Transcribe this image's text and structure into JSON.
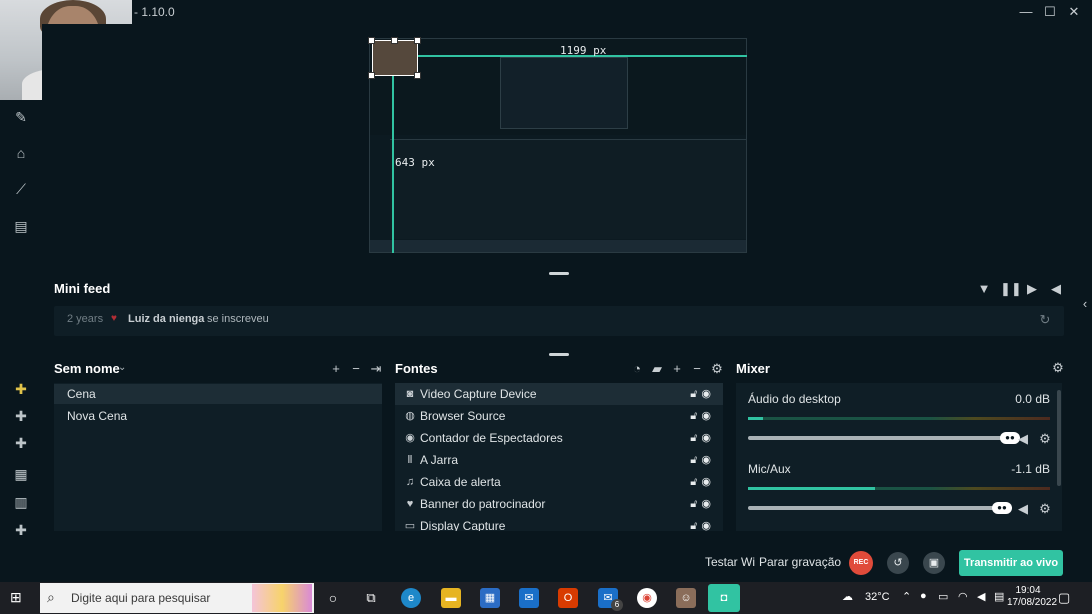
{
  "window": {
    "version": "- 1.10.0",
    "min": "—",
    "max": "☐",
    "close": "✕"
  },
  "preview": {
    "width_label": "1199 px",
    "height_label": "643 px"
  },
  "minifeed": {
    "title": "Mini feed",
    "item": {
      "time": "2 years",
      "user": "Luiz da nienga",
      "action": "se inscreveu"
    }
  },
  "scenes": {
    "title": "Sem nome",
    "items": [
      {
        "label": "Cena",
        "selected": true
      },
      {
        "label": "Nova Cena",
        "selected": false
      }
    ]
  },
  "sources": {
    "title": "Fontes",
    "items": [
      {
        "label": "Video Capture Device",
        "icon": "webcam-icon",
        "selected": true
      },
      {
        "label": "Browser Source",
        "icon": "globe-icon",
        "selected": false
      },
      {
        "label": "Contador de Espectadores",
        "icon": "eye-icon",
        "selected": false
      },
      {
        "label": "A Jarra",
        "icon": "text-icon",
        "selected": false
      },
      {
        "label": "Caixa de alerta",
        "icon": "bell-icon",
        "selected": false
      },
      {
        "label": "Banner do patrocinador",
        "icon": "heart-icon",
        "selected": false
      },
      {
        "label": "Display Capture",
        "icon": "monitor-icon",
        "selected": false
      }
    ]
  },
  "mixer": {
    "title": "Mixer",
    "channels": [
      {
        "name": "Áudio do desktop",
        "db": "0.0 dB",
        "level": 0.05,
        "volume": 1.0
      },
      {
        "name": "Mic/Aux",
        "db": "-1.1 dB",
        "level": 0.42,
        "volume": 0.97
      }
    ]
  },
  "bottombar": {
    "test_label": "Testar Wi",
    "stop_rec_label": "Parar gravação",
    "rec_label": "REC",
    "golive_label": "Transmitir ao vivo"
  },
  "taskbar": {
    "search_placeholder": "Digite aqui para pesquisar",
    "temperature": "32°C",
    "time": "19:04",
    "date": "17/08/2022",
    "mail_badge": "6"
  },
  "colors": {
    "accent": "#31c3a2",
    "rec": "#e04b3a",
    "background": "#09161d",
    "panel": "#0f1e26"
  }
}
